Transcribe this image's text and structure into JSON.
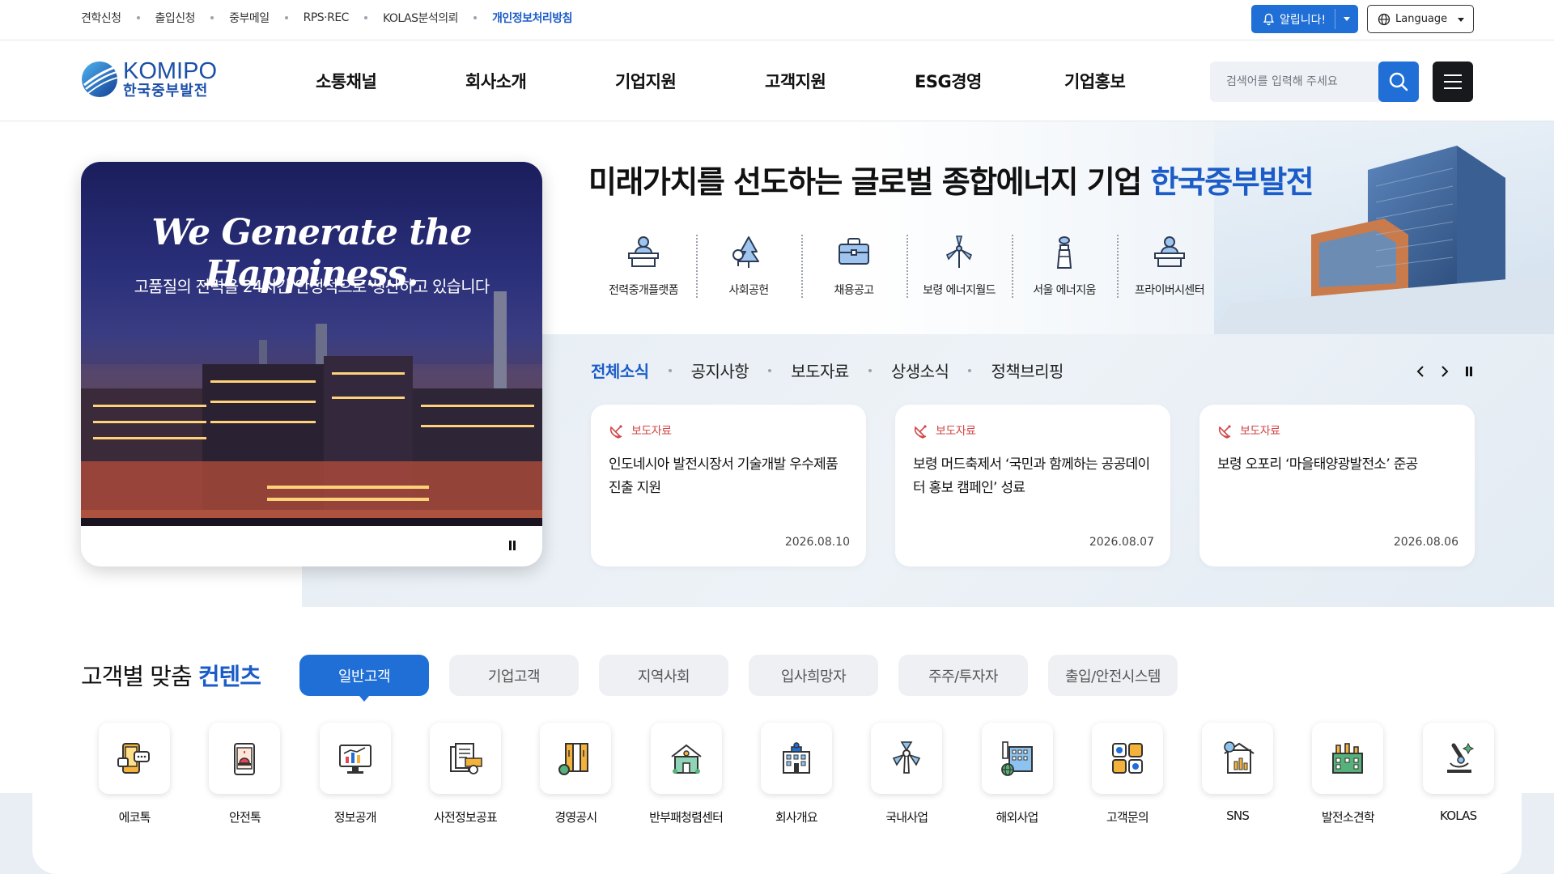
{
  "utility": {
    "links": [
      {
        "label": "견학신청",
        "active": false
      },
      {
        "label": "출입신청",
        "active": false
      },
      {
        "label": "중부메일",
        "active": false
      },
      {
        "label": "RPS·REC",
        "active": false
      },
      {
        "label": "KOLAS분석의뢰",
        "active": false
      },
      {
        "label": "개인정보처리방침",
        "active": true
      }
    ],
    "alert_label": "알립니다!",
    "language_label": "Language"
  },
  "header": {
    "logo_en": "KOMIPO",
    "logo_ko": "한국중부발전",
    "nav": [
      "소통채널",
      "회사소개",
      "기업지원",
      "고객지원",
      "ESG경영",
      "기업홍보"
    ],
    "search_placeholder": "검색어를 입력해 주세요"
  },
  "hero": {
    "slide_headline": "We Generate the Happiness.",
    "slide_sub": "고품질의 전력을 24시간 안정적으로 생산하고 있습니다",
    "title_prefix": "미래가치를 선도하는 글로벌 종합에너지 기업 ",
    "title_highlight": "한국중부발전",
    "quick_links": [
      {
        "label": "전력중개플랫폼",
        "icon": "podium-person-icon"
      },
      {
        "label": "사회공헌",
        "icon": "trees-icon"
      },
      {
        "label": "채용공고",
        "icon": "briefcase-icon"
      },
      {
        "label": "보령 에너지월드",
        "icon": "wind-turbine-icon"
      },
      {
        "label": "서울 에너지움",
        "icon": "tower-icon"
      },
      {
        "label": "프라이버시센터",
        "icon": "podium-person-icon"
      }
    ]
  },
  "news": {
    "tabs": [
      {
        "label": "전체소식",
        "active": true
      },
      {
        "label": "공지사항",
        "active": false
      },
      {
        "label": "보도자료",
        "active": false
      },
      {
        "label": "상생소식",
        "active": false
      },
      {
        "label": "정책브리핑",
        "active": false
      }
    ],
    "cards": [
      {
        "category": "보도자료",
        "title": "인도네시아 발전시장서 기술개발 우수제품 진출 지원",
        "date": "2026.08.10"
      },
      {
        "category": "보도자료",
        "title": "보령 머드축제서 ‘국민과 함께하는 공공데이터 홍보 캠페인’ 성료",
        "date": "2026.08.07"
      },
      {
        "category": "보도자료",
        "title": "보령 오포리 ‘마을태양광발전소’ 준공",
        "date": "2026.08.06"
      }
    ]
  },
  "custom": {
    "title_prefix": "고객별 맞춤 ",
    "title_highlight": "컨텐츠",
    "tabs": [
      {
        "label": "일반고객",
        "active": true
      },
      {
        "label": "기업고객",
        "active": false
      },
      {
        "label": "지역사회",
        "active": false
      },
      {
        "label": "입사희망자",
        "active": false
      },
      {
        "label": "주주/투자자",
        "active": false
      },
      {
        "label": "출입/안전시스템",
        "active": false
      }
    ],
    "items": [
      {
        "label": "에코톡",
        "icon": "chat-phone-icon"
      },
      {
        "label": "안전톡",
        "icon": "safety-phone-icon"
      },
      {
        "label": "정보공개",
        "icon": "monitor-chart-icon"
      },
      {
        "label": "사전정보공표",
        "icon": "documents-icon"
      },
      {
        "label": "경영공시",
        "icon": "binders-icon"
      },
      {
        "label": "반부패청렴센터",
        "icon": "house-icon"
      },
      {
        "label": "회사개요",
        "icon": "building-icon"
      },
      {
        "label": "국내사업",
        "icon": "turbine-icon"
      },
      {
        "label": "해외사업",
        "icon": "factory-globe-icon"
      },
      {
        "label": "고객문의",
        "icon": "grid-icon"
      },
      {
        "label": "SNS",
        "icon": "sns-icon"
      },
      {
        "label": "발전소견학",
        "icon": "plant-icon"
      },
      {
        "label": "KOLAS",
        "icon": "microscope-icon"
      }
    ]
  },
  "colors": {
    "accent": "#1f6fd6",
    "highlight": "#1b5cc8",
    "news_category": "#d34949"
  }
}
